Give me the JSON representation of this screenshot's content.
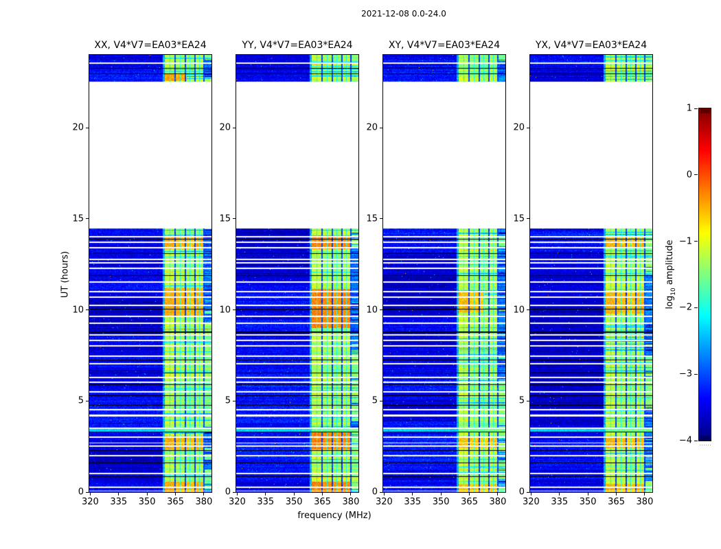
{
  "title": "2021-12-08 0.0-24.0",
  "chart_data": {
    "type": "heatmap",
    "title": "2021-12-08 0.0-24.0",
    "xlabel": "frequency (MHz)",
    "ylabel": "UT (hours)",
    "xlim": [
      319.5,
      384.0
    ],
    "ylim": [
      0,
      24
    ],
    "x_ticks": [
      320,
      335,
      350,
      365,
      380
    ],
    "x_tick_labels": [
      "320",
      "335",
      "350",
      "365",
      "380"
    ],
    "y_ticks": [
      0,
      5,
      10,
      15,
      20
    ],
    "y_tick_labels": [
      "0",
      "5",
      "10",
      "15",
      "20"
    ],
    "colormap": "jet",
    "colorbar": {
      "label_prefix": "log",
      "label_sub": "10",
      "label_suffix": " amplitude",
      "vmin": -4,
      "vmax": 1,
      "ticks": [
        1,
        0,
        -1,
        -2,
        -3,
        -4
      ],
      "tick_labels": [
        "1",
        "0",
        "−1",
        "−2",
        "−3",
        "−4"
      ]
    },
    "panels": [
      {
        "title": "XX, V4*V7=EA03*EA24",
        "seed": 101,
        "hot_level": -0.52,
        "hot": [
          [
            0.0,
            0.55,
            999
          ],
          [
            2.35,
            3.1,
            999
          ],
          [
            9.7,
            11.2,
            999
          ],
          [
            13.35,
            14.1,
            999
          ],
          [
            22.55,
            22.95,
            371
          ]
        ]
      },
      {
        "title": "YY, V4*V7=EA03*EA24",
        "seed": 202,
        "hot_level": -0.33,
        "hot": [
          [
            0.0,
            0.55,
            999
          ],
          [
            2.35,
            3.35,
            999
          ],
          [
            9.0,
            11.15,
            999
          ],
          [
            13.35,
            14.1,
            999
          ]
        ]
      },
      {
        "title": "XY, V4*V7=EA03*EA24",
        "seed": 303,
        "hot_level": -0.62,
        "hot": [
          [
            0.0,
            0.4,
            999
          ],
          [
            2.4,
            3.0,
            999
          ],
          [
            9.85,
            10.95,
            373
          ]
        ]
      },
      {
        "title": "YX, V4*V7=EA03*EA24",
        "seed": 404,
        "hot_level": -0.56,
        "hot": [
          [
            0.0,
            0.45,
            999
          ],
          [
            2.4,
            3.0,
            999
          ],
          [
            9.8,
            11.0,
            999
          ],
          [
            13.4,
            14.0,
            999
          ]
        ]
      }
    ],
    "time_coverage_hours": [
      [
        0.0,
        14.45
      ],
      [
        22.55,
        24.0
      ]
    ],
    "background_level": -3.45,
    "rfi_band_mhz": [
      359.5,
      384.0
    ],
    "rfi_band_level": -1.35,
    "band_gaps_mhz": [
      [
        364.5,
        365.2
      ],
      [
        370.0,
        370.7
      ],
      [
        374.8,
        375.5
      ],
      [
        379.8,
        380.4
      ]
    ],
    "band_minor_lines_mhz": [
      362.2,
      367.6,
      372.7,
      377.6
    ],
    "cyan_stripe_hours": [
      3.34,
      3.47
    ],
    "white_gap_hours": [
      [
        0.07,
        1
      ],
      [
        0.32,
        2
      ],
      [
        1.05,
        2
      ],
      [
        2.05,
        2
      ],
      [
        2.55,
        2
      ],
      [
        2.73,
        1
      ],
      [
        3.07,
        2
      ],
      [
        3.55,
        2
      ],
      [
        4.25,
        3
      ],
      [
        4.57,
        2
      ],
      [
        5.55,
        2
      ],
      [
        6.07,
        2
      ],
      [
        6.32,
        2
      ],
      [
        7.07,
        2
      ],
      [
        7.5,
        2
      ],
      [
        8.07,
        2
      ],
      [
        8.37,
        2
      ],
      [
        8.65,
        2
      ],
      [
        9.32,
        2
      ],
      [
        9.67,
        2
      ],
      [
        10.27,
        2
      ],
      [
        10.72,
        2
      ],
      [
        11.05,
        2
      ],
      [
        11.57,
        2
      ],
      [
        12.32,
        2
      ],
      [
        12.63,
        2
      ],
      [
        12.8,
        2
      ],
      [
        13.45,
        2
      ],
      [
        13.75,
        2
      ],
      [
        14.07,
        2
      ],
      [
        23.57,
        2
      ]
    ],
    "black_line_hours": [
      [
        0.87,
        1
      ],
      [
        1.62,
        1
      ],
      [
        2.3,
        1
      ],
      [
        3.32,
        1
      ],
      [
        4.78,
        1
      ],
      [
        5.3,
        1
      ],
      [
        5.92,
        1
      ],
      [
        6.55,
        1
      ],
      [
        7.27,
        1
      ],
      [
        8.82,
        2
      ],
      [
        10.07,
        1
      ],
      [
        11.92,
        1
      ],
      [
        13.12,
        1
      ],
      [
        13.92,
        1
      ],
      [
        22.98,
        1
      ],
      [
        23.27,
        1
      ]
    ]
  }
}
